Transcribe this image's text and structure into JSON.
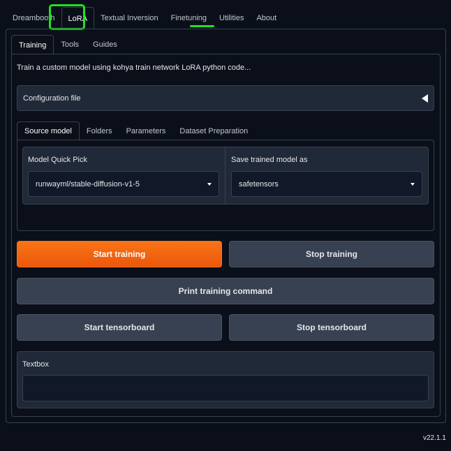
{
  "top_tabs": [
    "Dreambooth",
    "LoRA",
    "Textual Inversion",
    "Finetuning",
    "Utilities",
    "About"
  ],
  "selected_top_tab": "LoRA",
  "sub_tabs": [
    "Training",
    "Tools",
    "Guides"
  ],
  "selected_sub_tab": "Training",
  "description": "Train a custom model using kohya train network LoRA python code...",
  "config_file": {
    "label": "Configuration file"
  },
  "source_tabs": [
    "Source model",
    "Folders",
    "Parameters",
    "Dataset Preparation"
  ],
  "selected_source_tab": "Source model",
  "model_quick_pick": {
    "label": "Model Quick Pick",
    "value": "runwayml/stable-diffusion-v1-5"
  },
  "save_model_as": {
    "label": "Save trained model as",
    "value": "safetensors"
  },
  "buttons": {
    "start_training": "Start training",
    "stop_training": "Stop training",
    "print_command": "Print training command",
    "start_tensorboard": "Start tensorboard",
    "stop_tensorboard": "Stop tensorboard"
  },
  "textbox": {
    "label": "Textbox",
    "value": ""
  },
  "version": "v22.1.1",
  "colors": {
    "accent": "#f97316",
    "highlight": "#22e022",
    "background": "#0b0f19",
    "panel": "#1f2937"
  }
}
